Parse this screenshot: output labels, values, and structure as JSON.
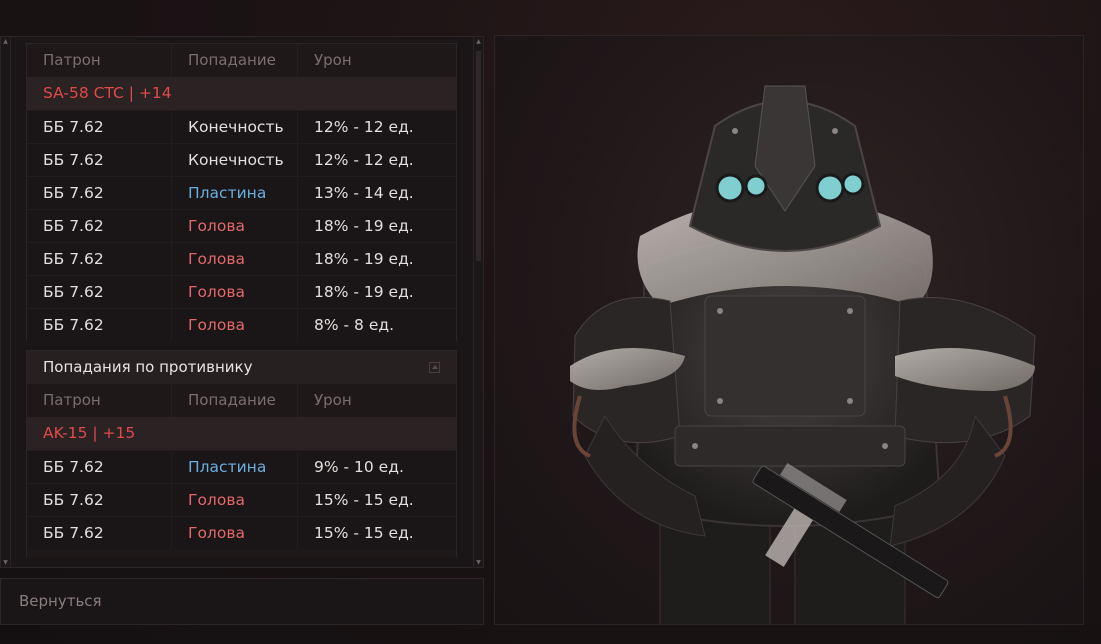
{
  "table": {
    "columns": {
      "ammo": "Патрон",
      "hit": "Попадание",
      "damage": "Урон"
    },
    "section1": {
      "weapon": "SA-58 CTC | +14",
      "rows": [
        {
          "ammo": "ББ 7.62",
          "hit": "Конечность",
          "hit_type": "limb",
          "damage": "12% - 12 ед."
        },
        {
          "ammo": "ББ 7.62",
          "hit": "Конечность",
          "hit_type": "limb",
          "damage": "12% - 12 ед."
        },
        {
          "ammo": "ББ 7.62",
          "hit": "Пластина",
          "hit_type": "plate",
          "damage": "13% - 14 ед."
        },
        {
          "ammo": "ББ 7.62",
          "hit": "Голова",
          "hit_type": "head",
          "damage": "18% - 19 ед."
        },
        {
          "ammo": "ББ 7.62",
          "hit": "Голова",
          "hit_type": "head",
          "damage": "18% - 19 ед."
        },
        {
          "ammo": "ББ 7.62",
          "hit": "Голова",
          "hit_type": "head",
          "damage": "18% - 19 ед."
        },
        {
          "ammo": "ББ 7.62",
          "hit": "Голова",
          "hit_type": "head",
          "damage": "8% - 8 ед."
        }
      ]
    },
    "section2": {
      "title": "Попадания по противнику",
      "weapon": "AK-15 | +15",
      "rows": [
        {
          "ammo": "ББ 7.62",
          "hit": "Пластина",
          "hit_type": "plate",
          "damage": "9% - 10 ед."
        },
        {
          "ammo": "ББ 7.62",
          "hit": "Голова",
          "hit_type": "head",
          "damage": "15% - 15 ед."
        },
        {
          "ammo": "ББ 7.62",
          "hit": "Голова",
          "hit_type": "head",
          "damage": "15% - 15 ед."
        }
      ]
    }
  },
  "colors": {
    "weapon": "#e04a4a",
    "head": "#e06a6a",
    "plate": "#6aaee0",
    "limb": "#e4dede"
  },
  "back_label": "Вернуться"
}
